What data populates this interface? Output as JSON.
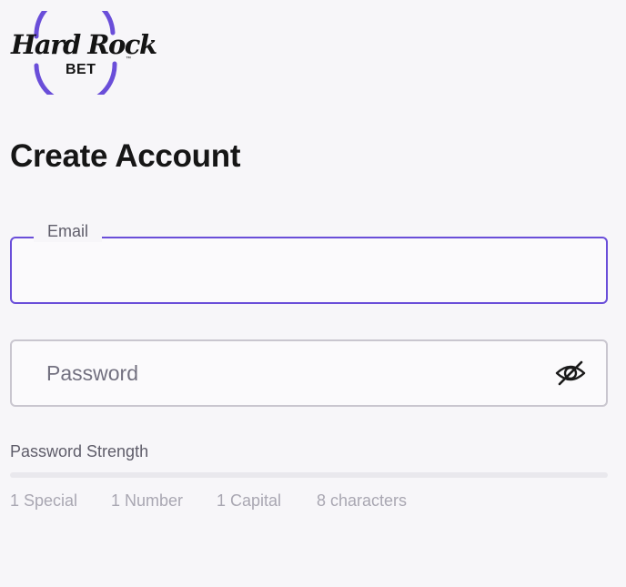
{
  "brand": {
    "wordmark": "Hard Rock",
    "sub": "BET",
    "tm": "™",
    "ring_color": "#6a4ed9"
  },
  "page": {
    "title": "Create Account"
  },
  "form": {
    "email": {
      "label": "Email",
      "value": "",
      "placeholder": ""
    },
    "password": {
      "placeholder": "Password",
      "value": "",
      "toggle_icon": "eye-slash-icon"
    }
  },
  "strength": {
    "label": "Password Strength",
    "level": 0,
    "requirements": [
      "1 Special",
      "1 Number",
      "1 Capital",
      "8 characters"
    ]
  },
  "colors": {
    "accent": "#6a4ed9",
    "background": "#f7f6f9",
    "muted_text": "#a9a7b2"
  }
}
